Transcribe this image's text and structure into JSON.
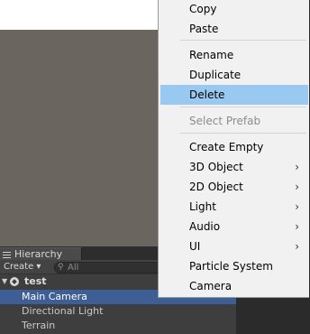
{
  "context_menu": {
    "items": [
      {
        "label": "Copy"
      },
      {
        "label": "Paste"
      },
      {
        "label": "Rename"
      },
      {
        "label": "Duplicate"
      },
      {
        "label": "Delete",
        "highlighted": true
      },
      {
        "label": "Select Prefab",
        "disabled": true
      },
      {
        "label": "Create Empty"
      },
      {
        "label": "3D Object",
        "submenu": true
      },
      {
        "label": "2D Object",
        "submenu": true
      },
      {
        "label": "Light",
        "submenu": true
      },
      {
        "label": "Audio",
        "submenu": true
      },
      {
        "label": "UI",
        "submenu": true
      },
      {
        "label": "Particle System"
      },
      {
        "label": "Camera"
      }
    ],
    "submenu_glyph": "›"
  },
  "hierarchy": {
    "tab_label": "Hierarchy",
    "create_label": "Create ▾",
    "search_placeholder": "All",
    "search_icon": "magnifier-icon",
    "scene_name": "test",
    "items": [
      "Main Camera",
      "Directional Light",
      "Terrain"
    ]
  },
  "colors": {
    "menu_background": "#f1f1f1",
    "menu_highlight": "#99c9f0",
    "selection": "#3e5f96",
    "scene_view": "#6a655f",
    "panel": "#3e3e3e"
  }
}
